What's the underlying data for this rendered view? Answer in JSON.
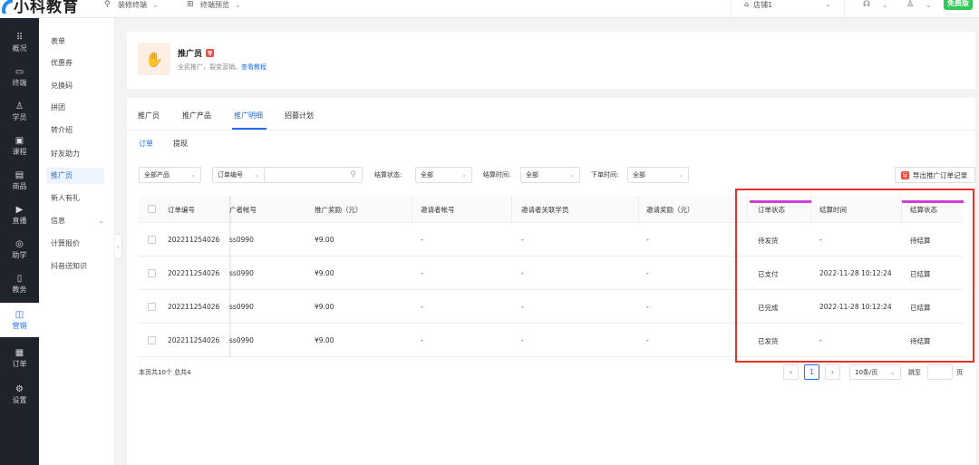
{
  "app": {
    "logo_text": "小科教育",
    "top_menu": [
      {
        "icon": "paint-icon",
        "label": "装修终端"
      },
      {
        "icon": "grid-icon",
        "label": "终端预览"
      }
    ],
    "store_label": "店铺1",
    "badge": "免费版"
  },
  "leftnav": [
    {
      "icon": "overview-icon",
      "glyph": "⠿",
      "label": "概况"
    },
    {
      "icon": "terminal-icon",
      "glyph": "▭",
      "label": "终端"
    },
    {
      "icon": "student-icon",
      "glyph": "♙",
      "label": "学员"
    },
    {
      "icon": "course-icon",
      "glyph": "▣",
      "label": "课程"
    },
    {
      "icon": "goods-icon",
      "glyph": "▤",
      "label": "商品"
    },
    {
      "icon": "live-icon",
      "glyph": "▶",
      "label": "直播"
    },
    {
      "icon": "assist-icon",
      "glyph": "◎",
      "label": "助学"
    },
    {
      "icon": "teaching-icon",
      "glyph": "▯",
      "label": "教务"
    },
    {
      "icon": "marketing-icon",
      "glyph": "◫",
      "label": "营销",
      "active": true
    },
    {
      "icon": "order-icon",
      "glyph": "▦",
      "label": "订单"
    },
    {
      "icon": "settings-icon",
      "glyph": "⚙",
      "label": "设置"
    }
  ],
  "subnav": {
    "items": [
      "表单",
      "优惠券",
      "兑换码",
      "拼团",
      "转介绍",
      "好友助力",
      "推广员",
      "新人有礼",
      "信息",
      "计算报价",
      "抖音送知识"
    ],
    "active_index": 6
  },
  "header": {
    "title": "推广员",
    "tag": "专",
    "desc": "全民推广，裂变营销。",
    "link": "查看教程"
  },
  "tabs": [
    "推广员",
    "推广产品",
    "推广明细",
    "招募计划"
  ],
  "active_tab": 2,
  "subtabs": [
    "订单",
    "提现"
  ],
  "filters": {
    "product": "全部产品",
    "order_no": "订单编号",
    "search_placeholder": "",
    "settle_status_label": "结算状态:",
    "settle_status_value": "全部",
    "settle_time_label": "结算时间:",
    "settle_time_value": "全部",
    "order_time_label": "下单时间:",
    "order_time_value": "全部",
    "export_label": "导出推广订单记录",
    "export_icon_text": "导"
  },
  "table": {
    "headers": [
      "订单编号",
      "广者帐号",
      "推广奖励（元）",
      "邀请者帐号",
      "邀请者关联学员",
      "邀请奖励（元）",
      "订单状态",
      "结算时间",
      "结算状态"
    ],
    "rows": [
      [
        "202211254026",
        "ss0990",
        "¥9.00",
        "-",
        "-",
        "-",
        "待发货",
        "-",
        "待结算"
      ],
      [
        "202211254026",
        "ss0990",
        "¥9.00",
        "-",
        "-",
        "-",
        "已支付",
        "2022-11-28 10:12:24",
        "已结算"
      ],
      [
        "202211254026",
        "ss0990",
        "¥9.00",
        "-",
        "-",
        "-",
        "已完成",
        "2022-11-28 10:12:24",
        "已结算"
      ],
      [
        "202211254026",
        "ss0990",
        "¥9.00",
        "-",
        "-",
        "-",
        "已发货",
        "-",
        "待结算"
      ]
    ]
  },
  "footer": {
    "summary": "本页共10个  总共4",
    "current_page": "1",
    "page_size": "10条/页",
    "jump_label": "跳至",
    "page_suffix": "页"
  },
  "colors": {
    "accent": "#1e6ff0",
    "annotation_box": "#e8312a",
    "annotation_line": "#d63bd4"
  }
}
